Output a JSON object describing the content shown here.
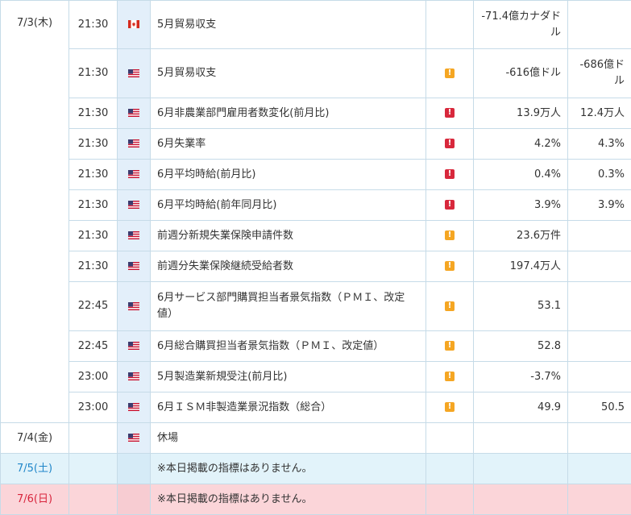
{
  "colors": {
    "importance_high": "#d8283c",
    "importance_mid": "#f5a623",
    "saturday": "#1f86c9",
    "sunday": "#d8243c"
  },
  "days": [
    {
      "date": "7/3(木)",
      "events": [
        {
          "time": "21:30",
          "country_icon": "canada-flag-icon",
          "indicator": "5月貿易収支",
          "importance": "",
          "previous": "-71.4億カナダドル",
          "forecast": ""
        },
        {
          "time": "21:30",
          "country_icon": "us-flag-icon",
          "indicator": "5月貿易収支",
          "importance": "mid",
          "previous": "-616億ドル",
          "forecast": "-686億ドル"
        },
        {
          "time": "21:30",
          "country_icon": "us-flag-icon",
          "indicator": "6月非農業部門雇用者数変化(前月比)",
          "importance": "high",
          "previous": "13.9万人",
          "forecast": "12.4万人"
        },
        {
          "time": "21:30",
          "country_icon": "us-flag-icon",
          "indicator": "6月失業率",
          "importance": "high",
          "previous": "4.2%",
          "forecast": "4.3%"
        },
        {
          "time": "21:30",
          "country_icon": "us-flag-icon",
          "indicator": "6月平均時給(前月比)",
          "importance": "high",
          "previous": "0.4%",
          "forecast": "0.3%"
        },
        {
          "time": "21:30",
          "country_icon": "us-flag-icon",
          "indicator": "6月平均時給(前年同月比)",
          "importance": "high",
          "previous": "3.9%",
          "forecast": "3.9%"
        },
        {
          "time": "21:30",
          "country_icon": "us-flag-icon",
          "indicator": "前週分新規失業保険申請件数",
          "importance": "mid",
          "previous": "23.6万件",
          "forecast": ""
        },
        {
          "time": "21:30",
          "country_icon": "us-flag-icon",
          "indicator": "前週分失業保険継続受給者数",
          "importance": "mid",
          "previous": "197.4万人",
          "forecast": ""
        },
        {
          "time": "22:45",
          "country_icon": "us-flag-icon",
          "indicator": "6月サービス部門購買担当者景気指数（ＰＭＩ、改定値）",
          "importance": "mid",
          "previous": "53.1",
          "forecast": ""
        },
        {
          "time": "22:45",
          "country_icon": "us-flag-icon",
          "indicator": "6月総合購買担当者景気指数（ＰＭＩ、改定値）",
          "importance": "mid",
          "previous": "52.8",
          "forecast": ""
        },
        {
          "time": "23:00",
          "country_icon": "us-flag-icon",
          "indicator": "5月製造業新規受注(前月比)",
          "importance": "mid",
          "previous": "-3.7%",
          "forecast": ""
        },
        {
          "time": "23:00",
          "country_icon": "us-flag-icon",
          "indicator": "6月ＩＳＭ非製造業景況指数（総合）",
          "importance": "mid",
          "previous": "49.9",
          "forecast": "50.5"
        }
      ]
    },
    {
      "date": "7/4(金)",
      "events": [
        {
          "time": "",
          "country_icon": "us-flag-icon",
          "indicator": "休場",
          "importance": "",
          "previous": "",
          "forecast": ""
        }
      ]
    },
    {
      "date": "7/5(土)",
      "type": "sat",
      "events": [
        {
          "time": "",
          "country_icon": "",
          "indicator": "※本日掲載の指標はありません。",
          "importance": "",
          "previous": "",
          "forecast": ""
        }
      ]
    },
    {
      "date": "7/6(日)",
      "type": "sun",
      "events": [
        {
          "time": "",
          "country_icon": "",
          "indicator": "※本日掲載の指標はありません。",
          "importance": "",
          "previous": "",
          "forecast": ""
        }
      ]
    }
  ]
}
